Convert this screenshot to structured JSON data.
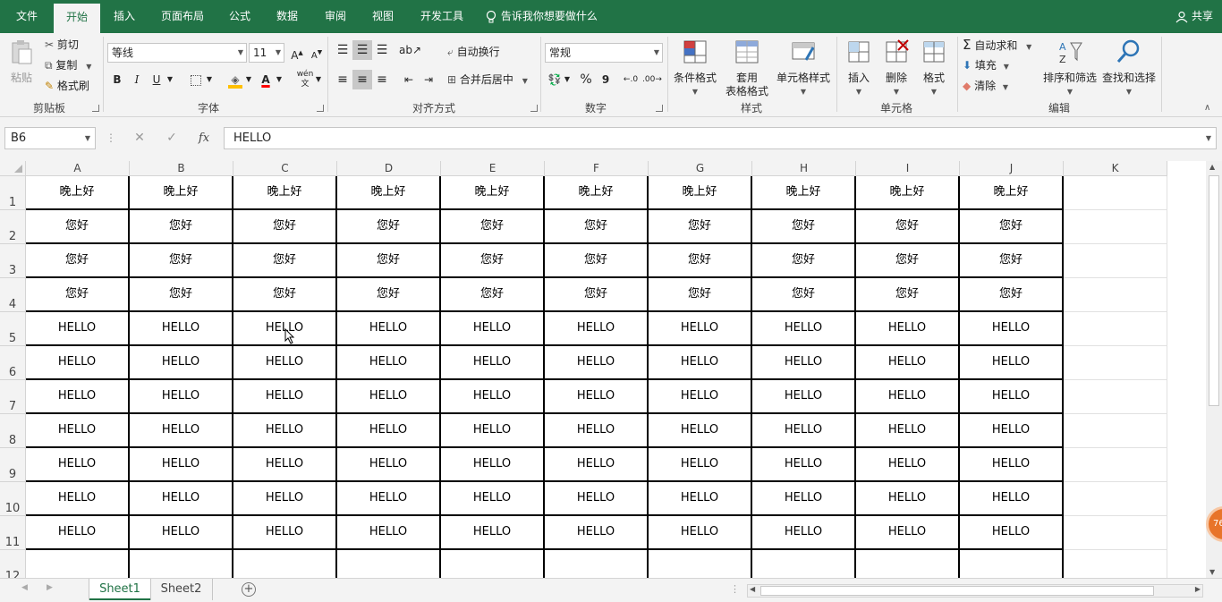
{
  "tabs": [
    "文件",
    "开始",
    "插入",
    "页面布局",
    "公式",
    "数据",
    "审阅",
    "视图",
    "开发工具"
  ],
  "active_tab": "开始",
  "tell_me": "告诉我你想要做什么",
  "share": "共享",
  "ribbon": {
    "clipboard": {
      "paste": "粘贴",
      "cut": "剪切",
      "copy": "复制",
      "format_painter": "格式刷",
      "label": "剪贴板"
    },
    "font": {
      "name": "等线",
      "size": "11",
      "bold": "B",
      "italic": "I",
      "underline": "U",
      "label": "字体",
      "wen": "wén",
      "wen_char": "文"
    },
    "alignment": {
      "wrap": "自动换行",
      "merge": "合并后居中",
      "label": "对齐方式"
    },
    "number": {
      "format": "常规",
      "percent": "%",
      "comma": "9",
      "label": "数字"
    },
    "styles": {
      "conditional": "条件格式",
      "table1": "套用",
      "table2": "表格格式",
      "cell_styles": "单元格样式",
      "label": "样式"
    },
    "cells": {
      "insert": "插入",
      "delete": "删除",
      "format": "格式",
      "label": "单元格"
    },
    "editing": {
      "autosum": "自动求和",
      "fill": "填充",
      "clear": "清除",
      "sort": "排序和筛选",
      "find": "查找和选择",
      "label": "编辑"
    }
  },
  "formula_bar": {
    "name_box": "B6",
    "fx": "fx",
    "value": "HELLO"
  },
  "columns": [
    "A",
    "B",
    "C",
    "D",
    "E",
    "F",
    "G",
    "H",
    "I",
    "J",
    "K"
  ],
  "rows": [
    {
      "num": "1",
      "cells": [
        "晚上好",
        "晚上好",
        "晚上好",
        "晚上好",
        "晚上好",
        "晚上好",
        "晚上好",
        "晚上好",
        "晚上好",
        "晚上好",
        ""
      ]
    },
    {
      "num": "2",
      "cells": [
        "您好",
        "您好",
        "您好",
        "您好",
        "您好",
        "您好",
        "您好",
        "您好",
        "您好",
        "您好",
        ""
      ]
    },
    {
      "num": "3",
      "cells": [
        "您好",
        "您好",
        "您好",
        "您好",
        "您好",
        "您好",
        "您好",
        "您好",
        "您好",
        "您好",
        ""
      ]
    },
    {
      "num": "4",
      "cells": [
        "您好",
        "您好",
        "您好",
        "您好",
        "您好",
        "您好",
        "您好",
        "您好",
        "您好",
        "您好",
        ""
      ]
    },
    {
      "num": "5",
      "cells": [
        "HELLO",
        "HELLO",
        "HELLO",
        "HELLO",
        "HELLO",
        "HELLO",
        "HELLO",
        "HELLO",
        "HELLO",
        "HELLO",
        ""
      ]
    },
    {
      "num": "6",
      "cells": [
        "HELLO",
        "HELLO",
        "HELLO",
        "HELLO",
        "HELLO",
        "HELLO",
        "HELLO",
        "HELLO",
        "HELLO",
        "HELLO",
        ""
      ]
    },
    {
      "num": "7",
      "cells": [
        "HELLO",
        "HELLO",
        "HELLO",
        "HELLO",
        "HELLO",
        "HELLO",
        "HELLO",
        "HELLO",
        "HELLO",
        "HELLO",
        ""
      ]
    },
    {
      "num": "8",
      "cells": [
        "HELLO",
        "HELLO",
        "HELLO",
        "HELLO",
        "HELLO",
        "HELLO",
        "HELLO",
        "HELLO",
        "HELLO",
        "HELLO",
        ""
      ]
    },
    {
      "num": "9",
      "cells": [
        "HELLO",
        "HELLO",
        "HELLO",
        "HELLO",
        "HELLO",
        "HELLO",
        "HELLO",
        "HELLO",
        "HELLO",
        "HELLO",
        ""
      ]
    },
    {
      "num": "10",
      "cells": [
        "HELLO",
        "HELLO",
        "HELLO",
        "HELLO",
        "HELLO",
        "HELLO",
        "HELLO",
        "HELLO",
        "HELLO",
        "HELLO",
        ""
      ]
    },
    {
      "num": "11",
      "cells": [
        "HELLO",
        "HELLO",
        "HELLO",
        "HELLO",
        "HELLO",
        "HELLO",
        "HELLO",
        "HELLO",
        "HELLO",
        "HELLO",
        ""
      ]
    },
    {
      "num": "12",
      "cells": [
        "",
        "",
        "",
        "",
        "",
        "",
        "",
        "",
        "",
        "",
        ""
      ]
    }
  ],
  "sheets": [
    "Sheet1",
    "Sheet2"
  ],
  "active_sheet": "Sheet1",
  "badge": "76",
  "colors": {
    "accent": "#217346",
    "ribbon_bg": "#f3f3f3",
    "highlight_fill": "#ffc000",
    "font_color": "#ff0000"
  }
}
